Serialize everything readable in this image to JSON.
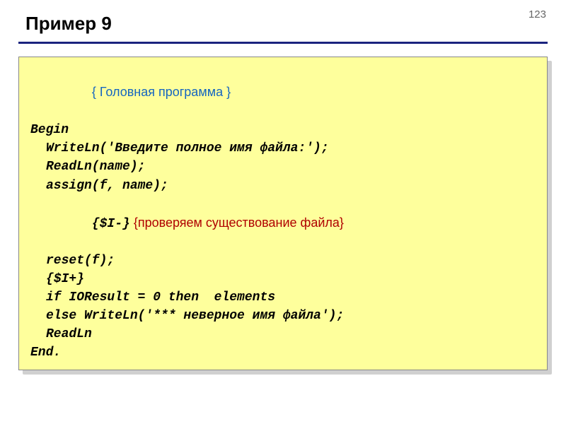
{
  "page_number": "123",
  "title": "Пример 9",
  "code": {
    "comment_header": "{ Головная программа }",
    "line_begin": "Begin",
    "line_writeln_prompt": "WriteLn('Введите полное имя файла:');",
    "line_readln_name": "ReadLn(name);",
    "line_assign": "assign(f, name);",
    "line_iminus": "{$I-}",
    "comment_checkfile": " {проверяем существование файла}",
    "line_reset": "reset(f);",
    "line_iplus": "{$I+}",
    "line_if": "if IOResult = 0 then  elements",
    "line_else": "else WriteLn('*** неверное имя файла');",
    "line_readln": "ReadLn",
    "line_end": "End."
  }
}
